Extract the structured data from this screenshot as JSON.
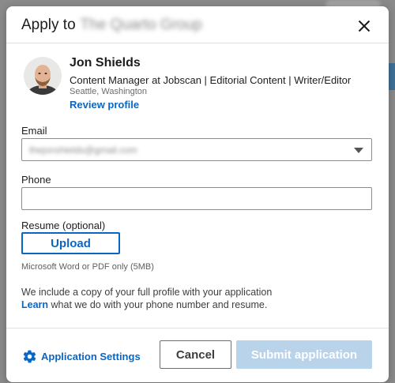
{
  "dialog": {
    "title_prefix": "Apply to",
    "company_name": "The Quarto Group"
  },
  "profile": {
    "name": "Jon Shields",
    "headline": "Content Manager at Jobscan | Editorial Content | Writer/Editor",
    "location": "Seattle, Washington",
    "review_link": "Review profile"
  },
  "form": {
    "email_label": "Email",
    "email_value": "thejonshields@gmail.com",
    "phone_label": "Phone",
    "phone_value": "",
    "resume_label": "Resume (optional)",
    "upload_label": "Upload",
    "resume_hint": "Microsoft Word or PDF only (5MB)"
  },
  "info": {
    "line1": "We include a copy of your full profile with your application",
    "learn_link": "Learn",
    "line2_rest": " what we do with your phone number and resume."
  },
  "footer": {
    "settings_label": "Application Settings",
    "cancel_label": "Cancel",
    "submit_label": "Submit application"
  },
  "colors": {
    "accent": "#0a66c2",
    "submit_disabled": "#b9d3ea",
    "text": "#1d1d1d"
  },
  "icons": {
    "close": "close-icon",
    "settings": "gear-icon",
    "dropdown": "chevron-down-icon"
  }
}
